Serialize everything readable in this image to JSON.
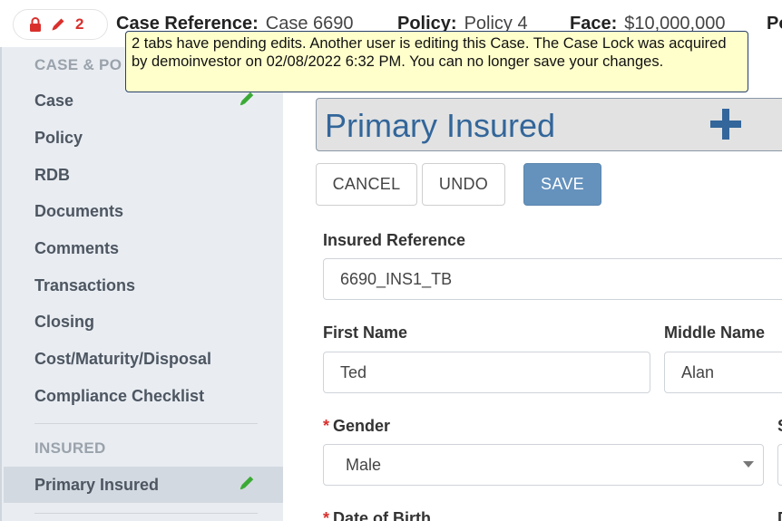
{
  "header": {
    "lock_count": "2",
    "case_ref_label": "Case Reference:",
    "case_ref_value": "Case 6690",
    "policy_label": "Policy:",
    "policy_value": "Policy 4",
    "face_label": "Face:",
    "face_value": "$10,000,000",
    "extra_label": "Po"
  },
  "tooltip": {
    "text": "2 tabs have pending edits. Another user is editing this Case. The Case Lock was acquired by demoinvestor on 02/08/2022 6:32 PM. You can no longer save your changes."
  },
  "sidebar": {
    "section_case": "CASE & PO",
    "items": [
      {
        "label": "Case"
      },
      {
        "label": "Policy"
      },
      {
        "label": "RDB"
      },
      {
        "label": "Documents"
      },
      {
        "label": "Comments"
      },
      {
        "label": "Transactions"
      },
      {
        "label": "Closing"
      },
      {
        "label": "Cost/Maturity/Disposal"
      },
      {
        "label": "Compliance Checklist"
      }
    ],
    "section_insured": "INSURED",
    "insured_items": [
      {
        "label": "Primary Insured"
      }
    ]
  },
  "panel": {
    "title": "Primary Insured"
  },
  "buttons": {
    "cancel": "CANCEL",
    "undo": "UNDO",
    "save": "SAVE"
  },
  "form": {
    "insured_reference_label": "Insured Reference",
    "insured_reference_value": "6690_INS1_TB",
    "first_name_label": "First Name",
    "first_name_value": "Ted",
    "middle_name_label": "Middle Name",
    "middle_name_value": "Alan",
    "gender_label": "Gender",
    "gender_value": "Male",
    "gender_required": "*",
    "dob_label": "Date of Birth",
    "dob_required": "*",
    "col2_partial_1": "S",
    "col2_partial_2": "D"
  },
  "colors": {
    "accent": "#33669a",
    "save": "#6592bd",
    "pencil_green": "#3aaa35",
    "lock_red": "#d9302c",
    "tooltip_bg": "#ffffcc"
  }
}
